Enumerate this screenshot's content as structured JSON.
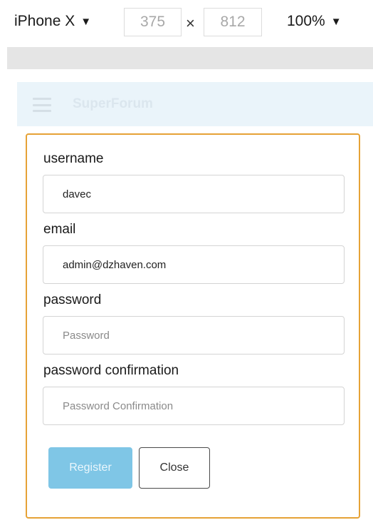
{
  "device_toolbar": {
    "device_name": "iPhone X",
    "width_value": "375",
    "height_value": "812",
    "zoom": "100%",
    "separator": "×",
    "dropdown_glyph": "▼"
  },
  "app": {
    "brand": "SuperForum",
    "header_color": "#eaf4fa"
  },
  "register_form": {
    "username_label": "username",
    "username_value": "davec",
    "email_label": "email",
    "email_value": "admin@dzhaven.com",
    "password_label": "password",
    "password_value": "",
    "password_placeholder": "Password",
    "confirm_label": "password confirmation",
    "confirm_value": "",
    "confirm_placeholder": "Password Confirmation",
    "register_label": "Register",
    "close_label": "Close",
    "accent_border": "#e6a236",
    "register_color": "#7fc6e6"
  },
  "icons": {
    "menu": "hamburger-menu-icon",
    "device_dropdown": "chevron-down-icon",
    "zoom_dropdown": "chevron-down-icon"
  }
}
